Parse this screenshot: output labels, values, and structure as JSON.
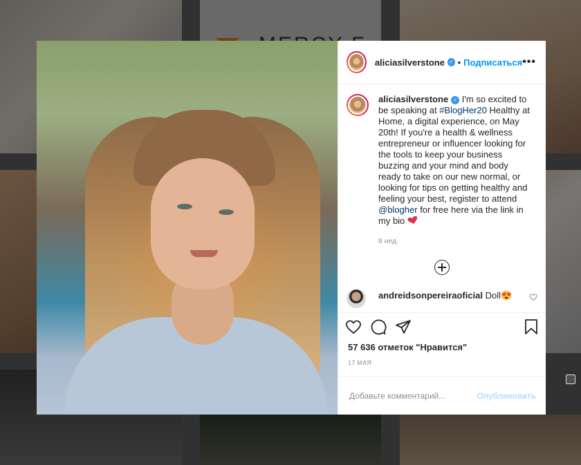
{
  "background": {
    "tile_text": "MERCY F"
  },
  "post": {
    "username": "aliciasilverstone",
    "follow_label": "Подписаться",
    "separator": "•",
    "more_label": "•••",
    "caption": {
      "username": "aliciasilverstone",
      "text_1": " I'm so excited to be speaking at ",
      "hashtag": "#BlogHer20",
      "text_2": " Healthy at Home, a digital experience, on May 20th! If you're a health & wellness entrepreneur or influencer looking for the tools to keep your business buzzing and your mind and body ready to take on our new normal, or looking for tips on getting healthy and feeling your best, register to attend ",
      "mention": "@blogher",
      "text_3": " for free here via the link in my bio ",
      "time": "8 нед."
    },
    "comments": [
      {
        "username": "andreidsonpereiraoficial",
        "text": " Doll",
        "emoji": "😍"
      }
    ],
    "likes": "57 636 отметок \"Нравится\"",
    "date": "17 МАЯ",
    "comment_input": {
      "placeholder": "Добавьте комментарий..."
    },
    "publish_label": "Опубликовать"
  },
  "colors": {
    "accent": "#0095f6",
    "verified": "#3897f0",
    "heart_emoji": "#d9304f"
  }
}
